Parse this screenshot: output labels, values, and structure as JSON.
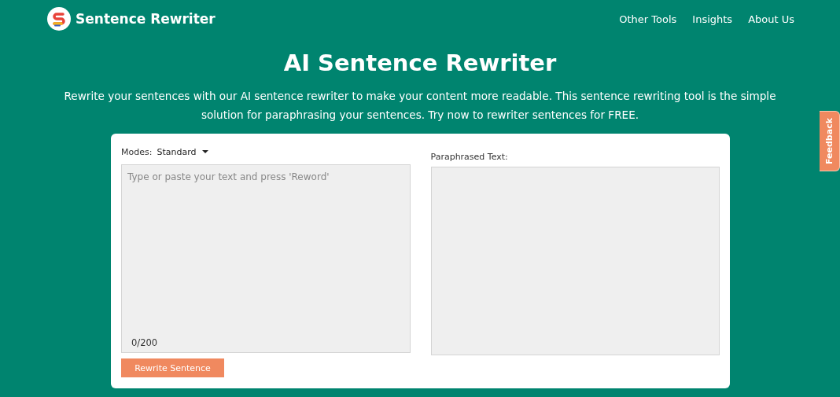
{
  "brand": {
    "name": "Sentence Rewriter"
  },
  "nav": [
    {
      "label": "Other Tools"
    },
    {
      "label": "Insights"
    },
    {
      "label": "About Us"
    }
  ],
  "hero": {
    "title": "AI Sentence Rewriter",
    "description": "Rewrite your sentences with our AI sentence rewriter to make your content more readable. This sentence rewriting tool is the simple solution for paraphrasing your sentences. Try now to rewriter sentences for FREE."
  },
  "input": {
    "modes_label": "Modes:",
    "mode": "Standard",
    "placeholder": "Type or paste your text and press 'Reword'",
    "counter": "0/200",
    "button": "Rewrite Sentence"
  },
  "output": {
    "label": "Paraphrased Text:"
  },
  "feedback": {
    "label": "Feedback"
  }
}
